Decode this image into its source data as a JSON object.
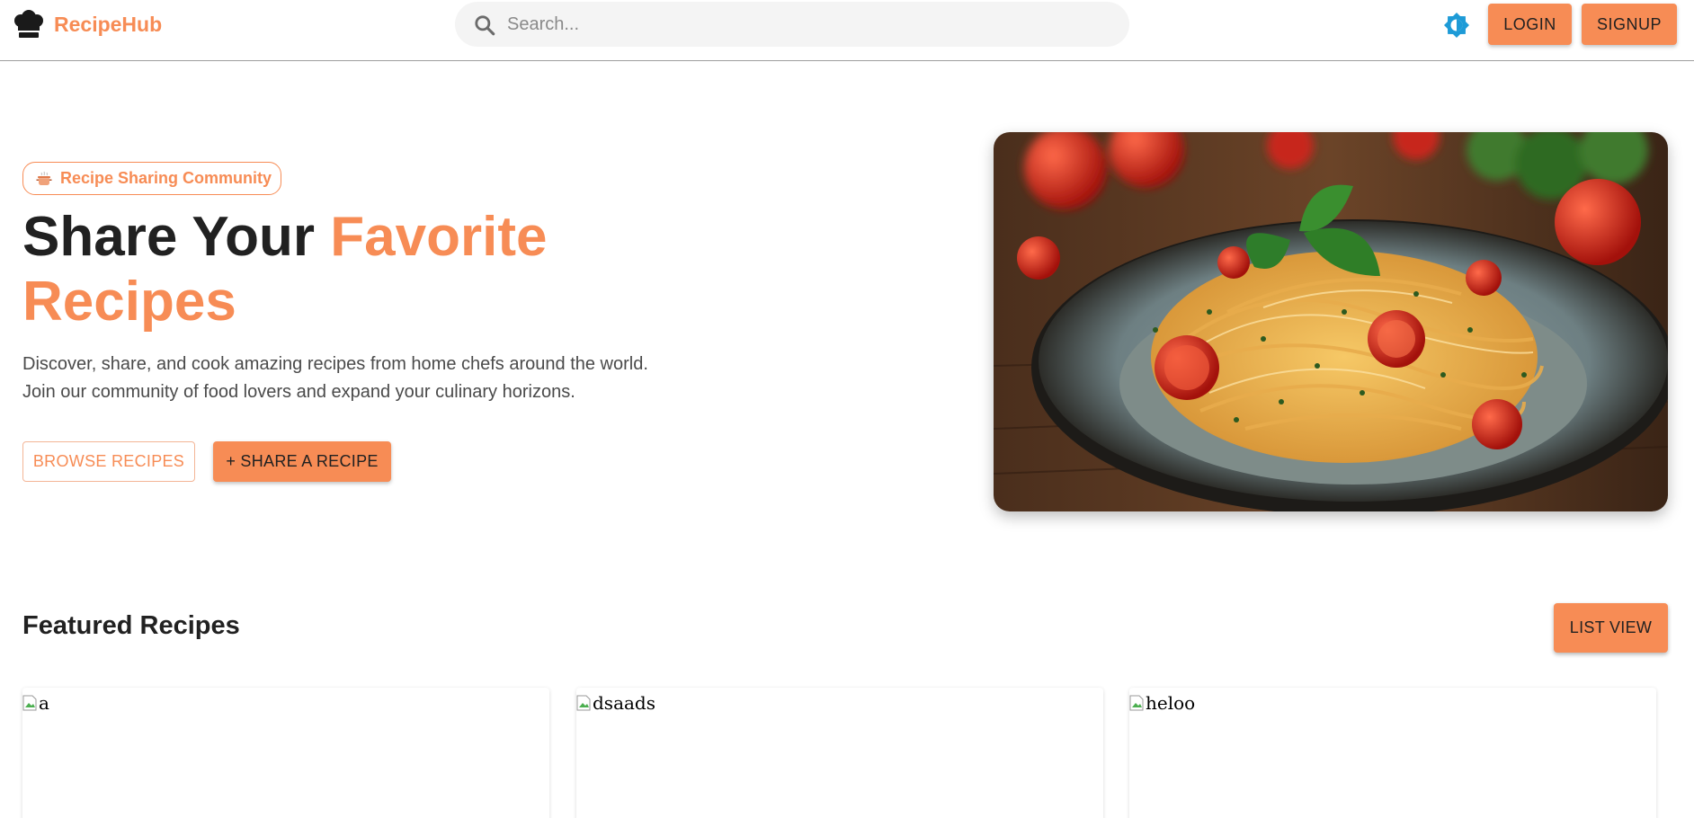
{
  "app": {
    "name": "RecipeHub",
    "accent_color": "#f78c55",
    "theme_icon_color": "#1e9bd7"
  },
  "header": {
    "logo_icon": "chef-hat-icon",
    "search": {
      "icon": "search-icon",
      "placeholder": "Search..."
    },
    "theme_toggle_icon": "brightness-icon",
    "login_label": "LOGIN",
    "signup_label": "SIGNUP"
  },
  "hero": {
    "badge": {
      "icon": "cooking-pot-icon",
      "text": "Recipe Sharing Community"
    },
    "title_prefix": "Share Your ",
    "title_accent": "Favorite Recipes",
    "description_line1": "Discover, share, and cook amazing recipes from home chefs around the world.",
    "description_line2": "Join our community of food lovers and expand your culinary horizons.",
    "browse_label": "BROWSE RECIPES",
    "share_label": "+ SHARE A RECIPE"
  },
  "featured": {
    "title": "Featured Recipes",
    "list_view_label": "LIST VIEW",
    "cards": [
      {
        "image_alt": "a"
      },
      {
        "image_alt": "dsaads"
      },
      {
        "image_alt": "heloo"
      }
    ]
  }
}
